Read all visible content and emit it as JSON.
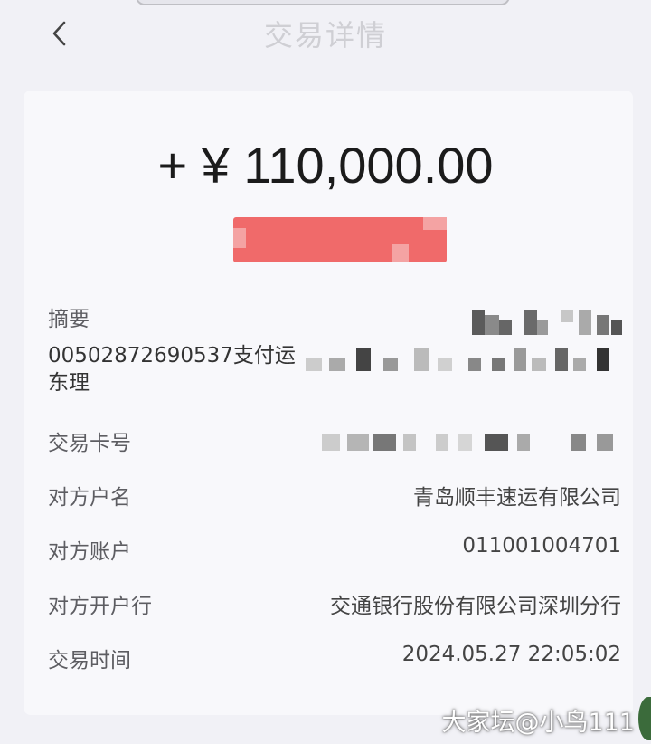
{
  "header": {
    "title": "交易详情"
  },
  "transaction": {
    "amount": "+ ¥ 110,000.00",
    "summary_label": "摘要",
    "summary_value": "00502872690537支付运东理",
    "card_label": "交易卡号",
    "payee_name_label": "对方户名",
    "payee_name": "青岛顺丰速运有限公司",
    "payee_account_label": "对方账户",
    "payee_account": "011001004701",
    "payee_bank_label": "对方开户行",
    "payee_bank": "交通银行股份有限公司深圳分行",
    "time_label": "交易时间",
    "time": "2024.05.27 22:05:02"
  },
  "watermark": "大家坛@小鸟111",
  "colors": {
    "redaction": "#f06a6a",
    "background": "#f1f1f6",
    "card": "#f8f8fb"
  },
  "icons": [
    "back-arrow-icon"
  ]
}
